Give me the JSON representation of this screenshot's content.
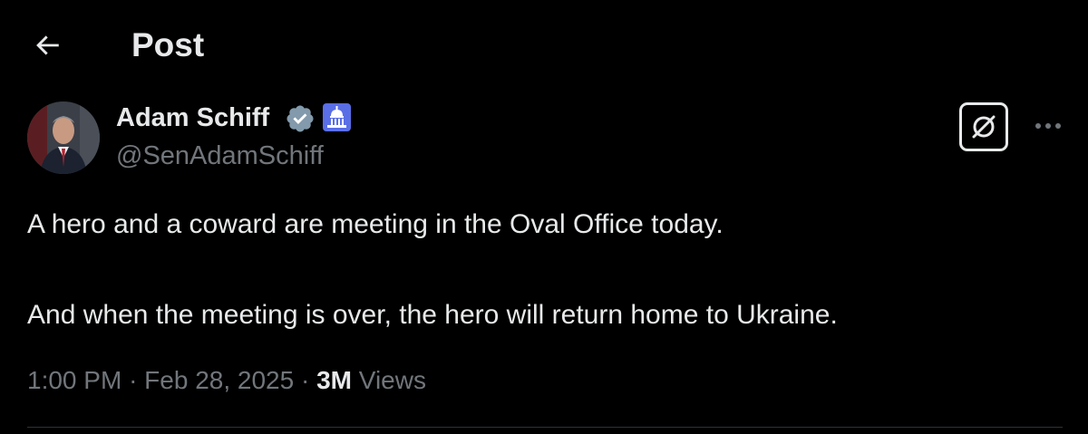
{
  "header": {
    "back_icon": "arrow-left-icon",
    "title": "Post"
  },
  "author": {
    "name": "Adam Schiff",
    "handle": "@SenAdamSchiff",
    "verified_icon": "verified-badge-icon",
    "affiliation_icon": "capitol-building-icon"
  },
  "actions": {
    "grok_icon": "grok-icon",
    "more_icon": "more-horizontal-icon"
  },
  "post": {
    "paragraphs": [
      "A hero and a coward are meeting in the Oval Office today.",
      "And when the meeting is over, the hero will return home to Ukraine."
    ]
  },
  "meta": {
    "time": "1:00 PM",
    "separator": "·",
    "date": "Feb 28, 2025",
    "views_count": "3M",
    "views_label": "Views"
  },
  "colors": {
    "background": "#000000",
    "primary_text": "#e7e9ea",
    "secondary_text": "#71767b",
    "verified_badge": "#829aab",
    "divider": "#2f3336",
    "gov_badge": "#5a6ee6"
  }
}
